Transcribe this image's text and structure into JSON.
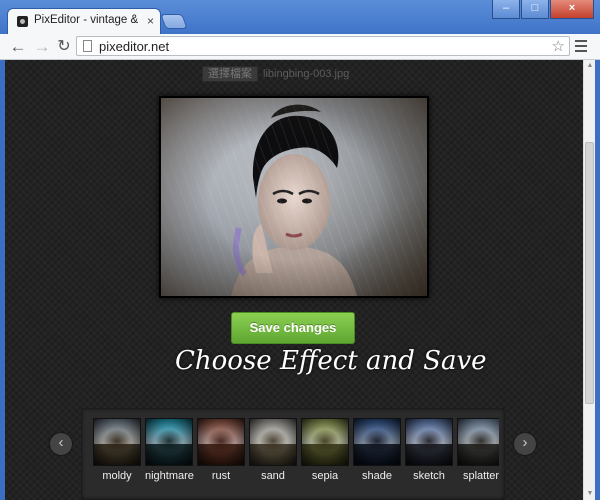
{
  "browser": {
    "tab_title": "PixEditor - vintage & retr",
    "tab_close": "×",
    "url": "pixeditor.net",
    "controls": {
      "minimize": "–",
      "maximize": "□",
      "close": "×"
    },
    "nav": {
      "back": "←",
      "forward": "→",
      "reload": "↻",
      "star": "☆"
    }
  },
  "page": {
    "file_button": "選擇檔案",
    "file_name": "libingbing-003.jpg",
    "save_button": "Save changes",
    "tagline": "Choose Effect and Save",
    "prev_arrow": "‹",
    "next_arrow": "›",
    "effects": [
      {
        "label": "moldy",
        "sky": "#6f8fb5",
        "tint": "rgba(90,70,40,0.35)"
      },
      {
        "label": "nightmare",
        "sky": "#27b9d6",
        "tint": "rgba(0,60,80,0.3)"
      },
      {
        "label": "rust",
        "sky": "#8a5c4e",
        "tint": "rgba(120,40,20,0.35)"
      },
      {
        "label": "sand",
        "sky": "#9ea3ad",
        "tint": "rgba(150,130,90,0.3)"
      },
      {
        "label": "sepia",
        "sky": "#8b9c5a",
        "tint": "rgba(120,120,40,0.35)"
      },
      {
        "label": "shade",
        "sky": "#3f6aa8",
        "tint": "rgba(0,20,60,0.35)"
      },
      {
        "label": "sketch",
        "sky": "#6c8fc8",
        "tint": "rgba(30,40,80,0.25)"
      },
      {
        "label": "splatter",
        "sky": "#90b0d8",
        "tint": "rgba(60,60,60,0.3)"
      }
    ]
  },
  "colors": {
    "save_button": "#6cb43c",
    "page_background": "#222222",
    "window_frame": "#3c6fc4"
  }
}
